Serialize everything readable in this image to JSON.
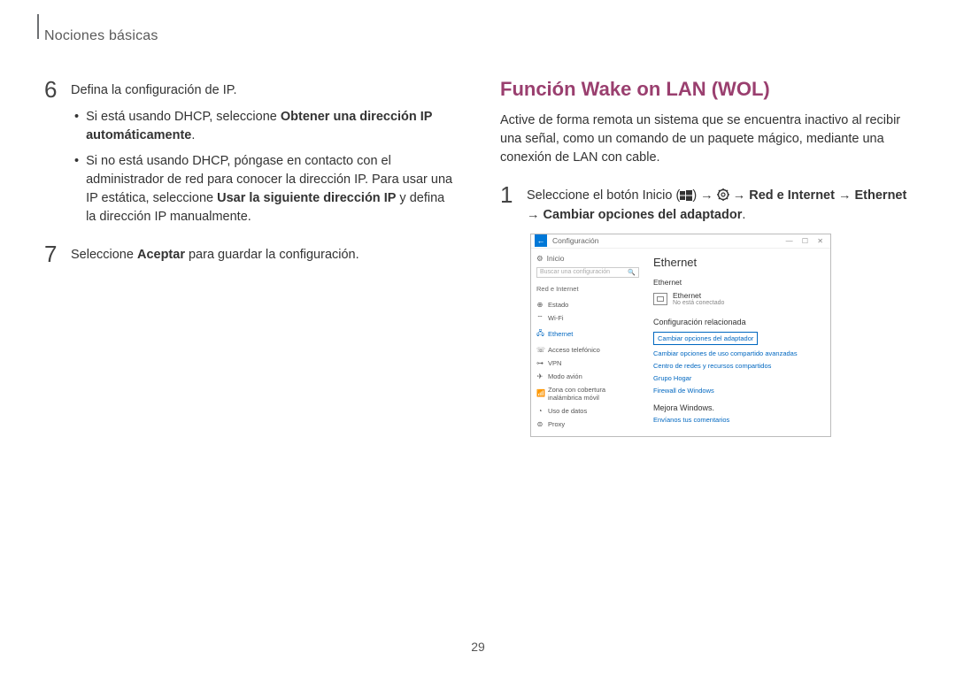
{
  "header": {
    "breadcrumb": "Nociones básicas"
  },
  "left": {
    "step6": {
      "num": "6",
      "lead": "Defina la configuración de IP.",
      "b1_pre": "Si está usando DHCP, seleccione ",
      "b1_bold": "Obtener una dirección IP automáticamente",
      "b1_post": ".",
      "b2_pre": "Si no está usando DHCP, póngase en contacto con el administrador de red para conocer la dirección IP. Para usar una IP estática, seleccione ",
      "b2_bold": "Usar la siguiente dirección IP",
      "b2_post": " y defina la dirección IP manualmente."
    },
    "step7": {
      "num": "7",
      "pre": "Seleccione ",
      "bold": "Aceptar",
      "post": " para guardar la configuración."
    }
  },
  "right": {
    "title": "Función Wake on LAN (WOL)",
    "intro": "Active de forma remota un sistema que se encuentra inactivo al recibir una señal, como un comando de un paquete mágico, mediante una conexión de LAN con cable.",
    "step1": {
      "num": "1",
      "pre": "Seleccione el botón Inicio (",
      "mid1": ") → ",
      "mid2": " → ",
      "bold1": "Red e Internet",
      "arrow": " → ",
      "bold2": "Ethernet",
      "arrow2": " → ",
      "bold3": "Cambiar opciones del adaptador",
      "post": "."
    }
  },
  "win": {
    "app": "Configuración",
    "ctrls": "—  ☐  ✕",
    "home": "Inicio",
    "search_ph": "Buscar una configuración",
    "cat": "Red e Internet",
    "items": {
      "estado": "Estado",
      "wifi": "Wi-Fi",
      "ethernet": "Ethernet",
      "acceso": "Acceso telefónico",
      "vpn": "VPN",
      "modo": "Modo avión",
      "zona": "Zona con cobertura inalámbrica móvil",
      "uso": "Uso de datos",
      "proxy": "Proxy"
    },
    "main": {
      "h1": "Ethernet",
      "h2": "Ethernet",
      "eth_name": "Ethernet",
      "eth_state": "No está conectado",
      "rel_h": "Configuración relacionada",
      "link_box": "Cambiar opciones del adaptador",
      "link1": "Cambiar opciones de uso compartido avanzadas",
      "link2": "Centro de redes y recursos compartidos",
      "link3": "Grupo Hogar",
      "link4": "Firewall de Windows",
      "improve_h": "Mejora Windows.",
      "improve_link": "Envíanos tus comentarios"
    }
  },
  "page": "29"
}
